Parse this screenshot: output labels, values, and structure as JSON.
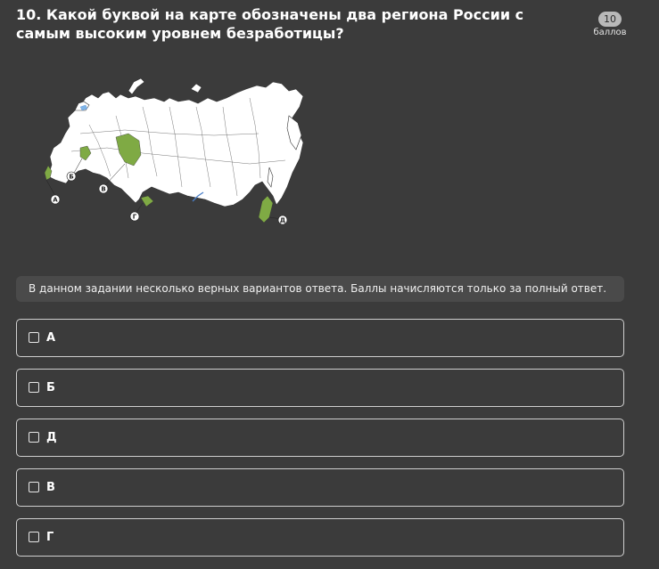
{
  "question": {
    "title": "10. Какой буквой на карте обозначены два региона России с самым высоким уровнем безработицы?",
    "points_value": "10",
    "points_label": "баллов"
  },
  "map": {
    "land_color": "#ffffff",
    "highlight_color": "#7faa44",
    "border_color": "#333333",
    "labels": [
      "А",
      "Б",
      "В",
      "Г",
      "Д"
    ]
  },
  "hint": {
    "text": "В данном задании несколько верных вариантов ответа. Баллы начисляются только за полный ответ."
  },
  "options": [
    {
      "label": "А",
      "checked": false
    },
    {
      "label": "Б",
      "checked": false
    },
    {
      "label": "Д",
      "checked": false
    },
    {
      "label": "В",
      "checked": false
    },
    {
      "label": "Г",
      "checked": false
    }
  ]
}
